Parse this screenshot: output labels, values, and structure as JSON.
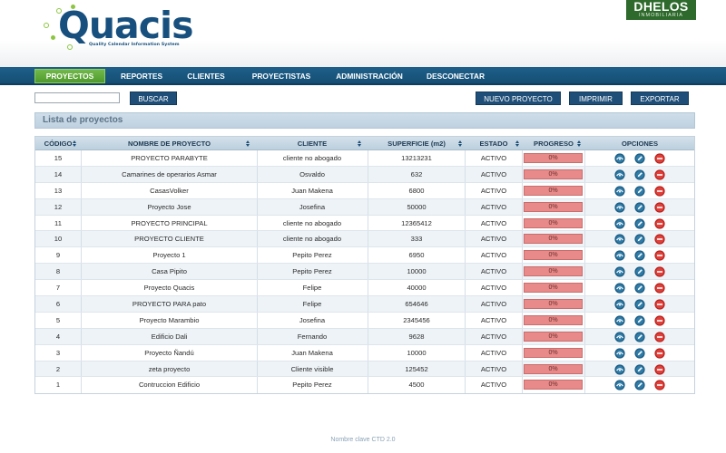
{
  "brand_left": {
    "name": "Quacis",
    "tagline": "Quality Calendar Information System"
  },
  "brand_right": {
    "name": "DHELOS",
    "subtitle": "INMOBILIARIA"
  },
  "nav": {
    "items": [
      {
        "label": "PROYECTOS",
        "active": true
      },
      {
        "label": "REPORTES",
        "active": false
      },
      {
        "label": "CLIENTES",
        "active": false
      },
      {
        "label": "PROYECTISTAS",
        "active": false
      },
      {
        "label": "ADMINISTRACIÓN",
        "active": false
      },
      {
        "label": "DESCONECTAR",
        "active": false
      }
    ]
  },
  "toolbar": {
    "search_value": "",
    "search_label": "BUSCAR",
    "new_label": "NUEVO PROYECTO",
    "print_label": "IMPRIMIR",
    "export_label": "EXPORTAR"
  },
  "panel": {
    "title": "Lista de proyectos"
  },
  "table": {
    "headers": {
      "code": "CÓDIGO",
      "name": "NOMBRE DE PROYECTO",
      "client": "CLIENTE",
      "area": "SUPERFICIE (m2)",
      "state": "ESTADO",
      "progress": "PROGRESO",
      "options": "OPCIONES"
    },
    "rows": [
      {
        "code": "15",
        "name": "PROYECTO PARABYTE",
        "client": "cliente no abogado",
        "area": "13213231",
        "state": "ACTIVO",
        "progress": "0%"
      },
      {
        "code": "14",
        "name": "Camarines de operarios Asmar",
        "client": "Osvaldo",
        "area": "632",
        "state": "ACTIVO",
        "progress": "0%"
      },
      {
        "code": "13",
        "name": "CasasVolker",
        "client": "Juan Makena",
        "area": "6800",
        "state": "ACTIVO",
        "progress": "0%"
      },
      {
        "code": "12",
        "name": "Proyecto Jose",
        "client": "Josefina",
        "area": "50000",
        "state": "ACTIVO",
        "progress": "0%"
      },
      {
        "code": "11",
        "name": "PROYECTO PRINCIPAL",
        "client": "cliente no abogado",
        "area": "12365412",
        "state": "ACTIVO",
        "progress": "0%"
      },
      {
        "code": "10",
        "name": "PROYECTO CLIENTE",
        "client": "cliente no abogado",
        "area": "333",
        "state": "ACTIVO",
        "progress": "0%"
      },
      {
        "code": "9",
        "name": "Proyecto 1",
        "client": "Pepito Perez",
        "area": "6950",
        "state": "ACTIVO",
        "progress": "0%"
      },
      {
        "code": "8",
        "name": "Casa Pipito",
        "client": "Pepito Perez",
        "area": "10000",
        "state": "ACTIVO",
        "progress": "0%"
      },
      {
        "code": "7",
        "name": "Proyecto Quacis",
        "client": "Felipe",
        "area": "40000",
        "state": "ACTIVO",
        "progress": "0%"
      },
      {
        "code": "6",
        "name": "PROYECTO PARA pato",
        "client": "Felipe",
        "area": "654646",
        "state": "ACTIVO",
        "progress": "0%"
      },
      {
        "code": "5",
        "name": "Proyecto Marambio",
        "client": "Josefina",
        "area": "2345456",
        "state": "ACTIVO",
        "progress": "0%"
      },
      {
        "code": "4",
        "name": "Edificio Dali",
        "client": "Fernando",
        "area": "9628",
        "state": "ACTIVO",
        "progress": "0%"
      },
      {
        "code": "3",
        "name": "Proyecto Ñandú",
        "client": "Juan Makena",
        "area": "10000",
        "state": "ACTIVO",
        "progress": "0%"
      },
      {
        "code": "2",
        "name": "zeta proyecto",
        "client": "Cliente visible",
        "area": "125452",
        "state": "ACTIVO",
        "progress": "0%"
      },
      {
        "code": "1",
        "name": "Contruccion Edificio",
        "client": "Pepito Perez",
        "area": "4500",
        "state": "ACTIVO",
        "progress": "0%"
      }
    ],
    "option_icons": [
      "view-icon",
      "edit-icon",
      "delete-icon"
    ]
  },
  "footer": {
    "text": "Nombre clave CTD 2.0"
  },
  "colors": {
    "navbar": "#1a5680",
    "active_tab": "#5fa83a",
    "button": "#1f4f78",
    "progress_bar": "#e88a89",
    "delete_icon": "#d9302c",
    "view_icon": "#1f5f86"
  }
}
